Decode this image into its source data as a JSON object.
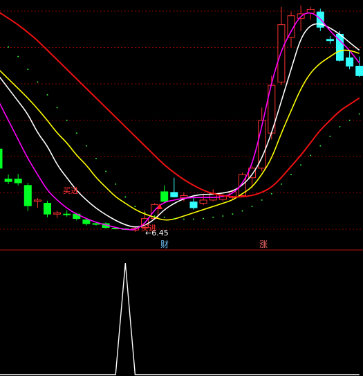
{
  "chart_data": [
    {
      "type": "candlestick",
      "panel": "price",
      "price_range": [
        6.2,
        10.0
      ],
      "candles": [
        {
          "o": 7.75,
          "h": 7.95,
          "l": 7.4,
          "c": 7.45
        },
        {
          "o": 7.28,
          "h": 7.35,
          "l": 7.2,
          "c": 7.24
        },
        {
          "o": 7.28,
          "h": 7.36,
          "l": 7.18,
          "c": 7.22
        },
        {
          "o": 7.18,
          "h": 7.22,
          "l": 6.78,
          "c": 6.86
        },
        {
          "o": 6.93,
          "h": 6.98,
          "l": 6.83,
          "c": 6.95
        },
        {
          "o": 6.9,
          "h": 6.94,
          "l": 6.68,
          "c": 6.73
        },
        {
          "o": 6.73,
          "h": 6.78,
          "l": 6.67,
          "c": 6.75
        },
        {
          "o": 6.73,
          "h": 6.79,
          "l": 6.69,
          "c": 6.72
        },
        {
          "o": 6.73,
          "h": 6.75,
          "l": 6.63,
          "c": 6.66
        },
        {
          "o": 6.64,
          "h": 6.66,
          "l": 6.55,
          "c": 6.58
        },
        {
          "o": 6.58,
          "h": 6.61,
          "l": 6.55,
          "c": 6.575
        },
        {
          "o": 6.58,
          "h": 6.6,
          "l": 6.5,
          "c": 6.52
        },
        {
          "o": 6.51,
          "h": 6.52,
          "l": 6.49,
          "c": 6.5
        },
        {
          "o": 6.5,
          "h": 6.51,
          "l": 6.48,
          "c": 6.49
        },
        {
          "o": 6.48,
          "h": 6.53,
          "l": 6.45,
          "c": 6.51
        },
        {
          "o": 6.52,
          "h": 6.78,
          "l": 6.5,
          "c": 6.66
        },
        {
          "o": 6.66,
          "h": 6.9,
          "l": 6.64,
          "c": 6.88
        },
        {
          "o": 7.08,
          "h": 7.18,
          "l": 6.9,
          "c": 6.93
        },
        {
          "o": 7.07,
          "h": 7.3,
          "l": 6.99,
          "c": 7.0
        },
        {
          "o": 6.99,
          "h": 7.07,
          "l": 6.93,
          "c": 7.02
        },
        {
          "o": 6.92,
          "h": 7.0,
          "l": 6.8,
          "c": 6.83
        },
        {
          "o": 6.9,
          "h": 7.05,
          "l": 6.87,
          "c": 6.95
        },
        {
          "o": 6.95,
          "h": 7.12,
          "l": 6.93,
          "c": 7.05
        },
        {
          "o": 6.96,
          "h": 7.04,
          "l": 6.93,
          "c": 7.02
        },
        {
          "o": 6.99,
          "h": 7.1,
          "l": 6.97,
          "c": 7.08
        },
        {
          "o": 7.02,
          "h": 7.38,
          "l": 7.0,
          "c": 7.35
        },
        {
          "o": 7.3,
          "h": 7.48,
          "l": 7.14,
          "c": 7.45
        },
        {
          "o": 7.45,
          "h": 8.4,
          "l": 7.4,
          "c": 8.2
        },
        {
          "o": 8.0,
          "h": 8.9,
          "l": 7.9,
          "c": 8.75
        },
        {
          "o": 8.8,
          "h": 9.98,
          "l": 8.75,
          "c": 9.7
        },
        {
          "o": 9.5,
          "h": 9.9,
          "l": 9.35,
          "c": 9.84
        },
        {
          "o": 9.8,
          "h": 10.0,
          "l": 9.6,
          "c": 9.87
        },
        {
          "o": 9.88,
          "h": 9.98,
          "l": 9.78,
          "c": 9.94
        },
        {
          "o": 9.9,
          "h": 9.95,
          "l": 9.6,
          "c": 9.66
        },
        {
          "o": 9.47,
          "h": 9.52,
          "l": 9.4,
          "c": 9.45
        },
        {
          "o": 9.55,
          "h": 9.6,
          "l": 9.12,
          "c": 9.14
        },
        {
          "o": 9.18,
          "h": 9.3,
          "l": 9.0,
          "c": 9.05
        },
        {
          "o": 9.05,
          "h": 9.2,
          "l": 8.88,
          "c": 8.9
        }
      ],
      "moving_averages": [
        {
          "color": "#ffffff",
          "values": [
            8.9,
            8.7,
            8.5,
            8.3,
            8.0,
            7.8,
            7.5,
            7.3,
            7.1,
            6.95,
            6.82,
            6.72,
            6.63,
            6.56,
            6.52,
            6.55,
            6.65,
            6.8,
            6.9,
            6.97,
            7.02,
            7.04,
            7.04,
            7.06,
            7.09,
            7.18,
            7.34,
            7.6,
            8.0,
            8.5,
            9.0,
            9.5,
            9.7,
            9.72,
            9.65,
            9.55,
            9.42,
            9.3
          ]
        },
        {
          "color": "#ff00ff",
          "values": [
            8.5,
            8.2,
            7.9,
            7.6,
            7.35,
            7.1,
            6.95,
            6.82,
            6.73,
            6.66,
            6.6,
            6.56,
            6.52,
            6.49,
            6.48,
            6.58,
            6.8,
            6.92,
            6.95,
            6.98,
            6.99,
            6.99,
            6.99,
            7.0,
            7.05,
            7.2,
            7.5,
            8.1,
            8.8,
            9.3,
            9.6,
            9.85,
            9.9,
            9.8,
            9.6,
            9.45,
            9.3,
            9.1
          ]
        },
        {
          "color": "#ffff00",
          "values": [
            9.0,
            8.85,
            8.7,
            8.55,
            8.38,
            8.2,
            8.0,
            7.85,
            7.65,
            7.5,
            7.3,
            7.15,
            7.0,
            6.9,
            6.8,
            6.73,
            6.68,
            6.63,
            6.65,
            6.7,
            6.75,
            6.8,
            6.85,
            6.9,
            6.95,
            7.05,
            7.15,
            7.35,
            7.6,
            8.0,
            8.35,
            8.7,
            8.95,
            9.1,
            9.2,
            9.3,
            9.3,
            9.25
          ]
        },
        {
          "color": "#ee1111",
          "values": [
            9.9,
            9.8,
            9.7,
            9.58,
            9.45,
            9.3,
            9.15,
            9.0,
            8.85,
            8.7,
            8.55,
            8.4,
            8.25,
            8.1,
            7.95,
            7.8,
            7.65,
            7.5,
            7.38,
            7.27,
            7.18,
            7.1,
            7.05,
            7.02,
            7.0,
            7.0,
            7.02,
            7.07,
            7.15,
            7.3,
            7.48,
            7.65,
            7.85,
            8.05,
            8.2,
            8.35,
            8.45,
            8.55
          ]
        },
        {
          "color": "#33ee33",
          "style": "dotted",
          "values": [
            9.5,
            9.35,
            9.2,
            9.0,
            8.8,
            8.6,
            8.4,
            8.2,
            8.0,
            7.8,
            7.6,
            7.4,
            7.2,
            7.0,
            6.85,
            6.75,
            6.7,
            6.68,
            6.66,
            6.65,
            6.65,
            6.66,
            6.68,
            6.7,
            6.73,
            6.78,
            6.85,
            6.95,
            7.05,
            7.2,
            7.35,
            7.5,
            7.65,
            7.8,
            7.95,
            8.1,
            8.2,
            8.3
          ]
        }
      ],
      "annotations": [
        {
          "text": "←6.45",
          "price": 6.45,
          "color": "#ffffff"
        },
        {
          "text": "买进",
          "color": "#ff3030",
          "candle_index": 4
        },
        {
          "text": "买进",
          "color": "#ff3030",
          "candle_index": 14
        }
      ]
    },
    {
      "type": "line",
      "panel": "indicator",
      "color": "#ffffff",
      "values": [
        0,
        0,
        0,
        0,
        0,
        0,
        0,
        0,
        0,
        0,
        0,
        0,
        0,
        1,
        0,
        0,
        0,
        0,
        0,
        0,
        0,
        0,
        0,
        0,
        0,
        0,
        0,
        0,
        0,
        0,
        0,
        0,
        0,
        0,
        0,
        0,
        0,
        0
      ],
      "ylim": [
        0,
        1
      ]
    }
  ],
  "separator_labels": [
    {
      "text": "财",
      "color": "#6fc8ff"
    },
    {
      "text": "涨",
      "color": "#ff6a6a"
    }
  ],
  "colors": {
    "up": "#ff3232",
    "down_green": "#00ff22",
    "down_cyan": "#33ffff",
    "grid": "#8b0000",
    "separator": "#c01010"
  }
}
